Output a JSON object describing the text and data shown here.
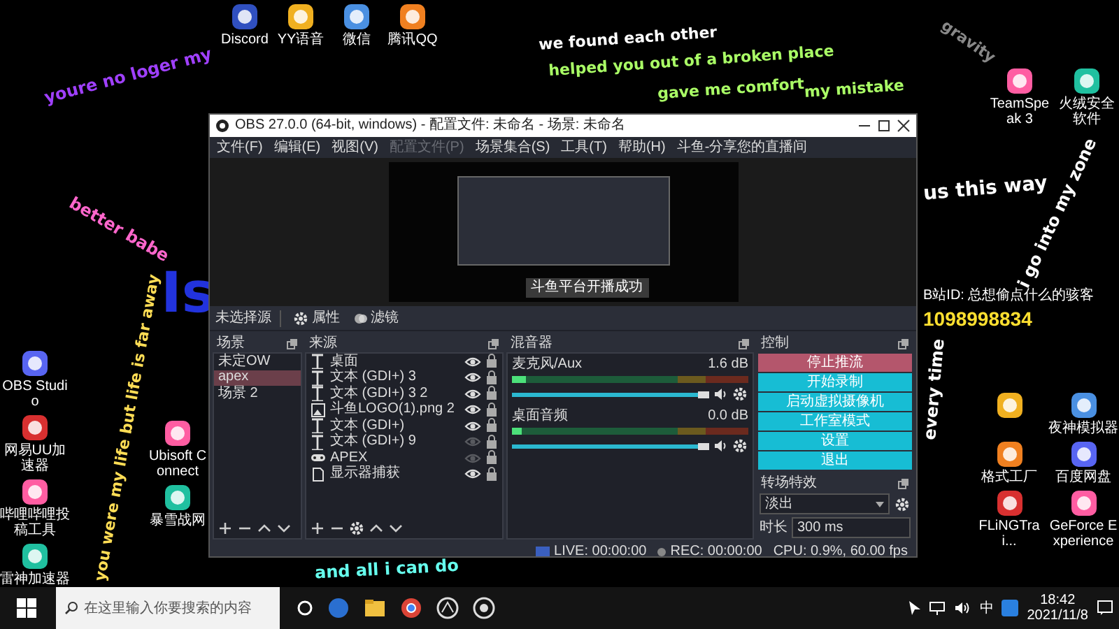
{
  "top_icons": [
    {
      "label": "Discord"
    },
    {
      "label": "YY语音"
    },
    {
      "label": "微信"
    },
    {
      "label": "腾讯QQ"
    }
  ],
  "left_icons": [
    {
      "label": "OBS Studio"
    },
    {
      "label": "网易UU加速器"
    },
    {
      "label": "哔哩哔哩投稿工具"
    },
    {
      "label": "雷神加速器"
    }
  ],
  "left_icons_2": [
    {
      "label": "Ubisoft Connect"
    },
    {
      "label": "暴雪战网"
    }
  ],
  "right_top_icons": [
    {
      "label": "TeamSpeak 3"
    },
    {
      "label": "火绒安全软件"
    }
  ],
  "right_icons": [
    {
      "kind": "app"
    },
    {
      "label": "夜神模拟器"
    },
    {
      "label": "格式工厂"
    },
    {
      "label": "百度网盘"
    },
    {
      "label": "FLiNGTrai..."
    },
    {
      "label": "GeForce Experience"
    }
  ],
  "lyrics": [
    {
      "text": "youre no loger my"
    },
    {
      "text": "we found each other"
    },
    {
      "text": "helped you out of a broken place"
    },
    {
      "text": "gave me comfort"
    },
    {
      "text": "my mistake"
    },
    {
      "text": "gravity"
    },
    {
      "text": "us this way"
    },
    {
      "text": "i go into my zone"
    },
    {
      "text": "better babe"
    },
    {
      "text": "you were my life but life is far away"
    },
    {
      "text": "and all i can do"
    },
    {
      "text": "every time"
    },
    {
      "text": "Is"
    }
  ],
  "overlay_texts": [
    "B站ID: 总想偷点什么的骇客",
    "1098998834"
  ],
  "obs": {
    "title": "OBS 27.0.0 (64-bit, windows) - 配置文件: 未命名 - 场景: 未命名",
    "menu": [
      {
        "label": "文件(F)",
        "disabled": false
      },
      {
        "label": "编辑(E)",
        "disabled": false
      },
      {
        "label": "视图(V)",
        "disabled": false
      },
      {
        "label": "配置文件(P)",
        "disabled": true
      },
      {
        "label": "场景集合(S)",
        "disabled": false
      },
      {
        "label": "工具(T)",
        "disabled": false
      },
      {
        "label": "帮助(H)",
        "disabled": false
      },
      {
        "label": "斗鱼-分享您的直播间",
        "disabled": false
      }
    ],
    "preview": {
      "toast": "斗鱼平台开播成功"
    },
    "toolbar": {
      "source": "未选择源",
      "properties": "属性",
      "filters": "滤镜"
    },
    "scenes": {
      "title": "场景",
      "items": [
        {
          "label": "未定OW",
          "selected": false
        },
        {
          "label": "apex",
          "selected": true
        },
        {
          "label": "场景 2",
          "selected": false
        }
      ]
    },
    "sources": {
      "title": "来源",
      "items": [
        {
          "label": "桌面",
          "kind": "text",
          "visible": true
        },
        {
          "label": "文本 (GDI+) 3",
          "kind": "text",
          "visible": true
        },
        {
          "label": "文本 (GDI+) 3 2",
          "kind": "text",
          "visible": true
        },
        {
          "label": "斗鱼LOGO(1).png 2",
          "kind": "image",
          "visible": true
        },
        {
          "label": "文本 (GDI+)",
          "kind": "text",
          "visible": true
        },
        {
          "label": "文本 (GDI+) 9",
          "kind": "text",
          "visible": false
        },
        {
          "label": "APEX",
          "kind": "game",
          "visible": false
        },
        {
          "label": "显示器捕获",
          "kind": "display",
          "visible": true
        }
      ]
    },
    "mixer": {
      "title": "混音器",
      "channels": [
        {
          "name": "麦克风/Aux",
          "reading": "1.6 dB",
          "meter": {
            "level": 0.06
          },
          "volume": {
            "level": 0.97
          }
        },
        {
          "name": "桌面音频",
          "reading": "0.0 dB",
          "meter": {
            "level": 0.04
          },
          "volume": {
            "level": 0.97
          }
        }
      ]
    },
    "controls": {
      "title": "控制",
      "buttons": [
        {
          "label": "停止推流",
          "active": true
        },
        {
          "label": "开始录制",
          "active": false
        },
        {
          "label": "启动虚拟摄像机",
          "active": false
        },
        {
          "label": "工作室模式",
          "active": false
        },
        {
          "label": "设置",
          "active": false
        },
        {
          "label": "退出",
          "active": false
        }
      ]
    },
    "transitions": {
      "title": "转场特效",
      "type": "淡出",
      "duration_label": "时长",
      "duration": "300 ms"
    },
    "status": {
      "live": "LIVE: 00:00:00",
      "rec": "REC: 00:00:00",
      "cpu": "CPU: 0.9%, 60.00 fps"
    }
  },
  "taskbar": {
    "search_placeholder": "在这里输入你要搜索的内容",
    "ime": "中",
    "time": "18:42",
    "date": "2021/11/8"
  }
}
